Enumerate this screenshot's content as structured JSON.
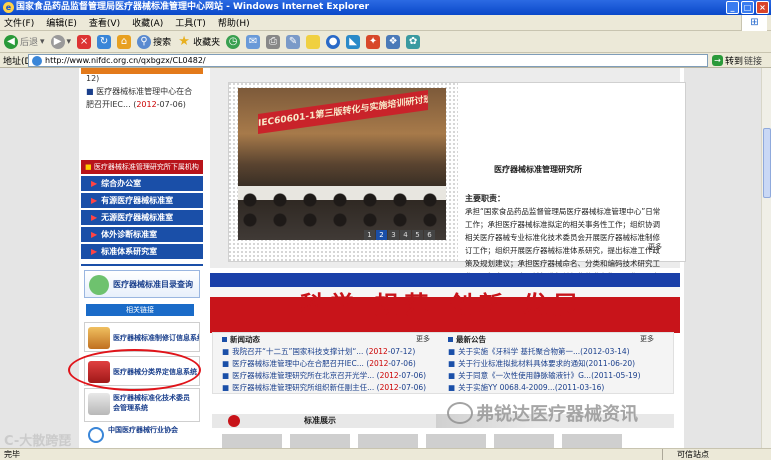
{
  "window": {
    "title": "国家食品药品监督管理局医疗器械标准管理中心网站 - Windows Internet Explorer",
    "title_bar_color": "#0a48c9"
  },
  "menu": [
    "文件(F)",
    "编辑(E)",
    "查看(V)",
    "收藏(A)",
    "工具(T)",
    "帮助(H)"
  ],
  "toolbar": {
    "back": "后退",
    "search": "搜索",
    "favorites": "收藏夹"
  },
  "address": {
    "label": "地址(D)",
    "url": "http://www.nifdc.org.cn/qxbgzx/CL0482/",
    "go": "转到",
    "links": "链接"
  },
  "left": {
    "news": [
      {
        "text": "12)",
        "date": ""
      },
      {
        "text": "医疗器械标准管理中心在合肥召开IEC...",
        "date_prefix": "(",
        "year": "2012",
        "date": "-07-06)"
      }
    ],
    "agency_header": "医疗器械标准管理研究所下属机构",
    "agency_items": [
      "综合办公室",
      "有源医疗器械标准室",
      "无源医疗器械标准室",
      "体外诊断标准室",
      "标准体系研究室"
    ],
    "query_button": "医疗器械标准目录查询",
    "related_links": "相关链接",
    "systems": [
      "医疗器械标准制修订信息系统",
      "医疗器械分类界定信息系统",
      "医疗器械标准化技术委员会管理系统"
    ],
    "assoc": "中国医疗器械行业协会"
  },
  "feature": {
    "banner": "IEC60601-1第三版转化与实施培训研讨班第二次工作会议",
    "pager": [
      "1",
      "2",
      "3",
      "4",
      "5",
      "6"
    ],
    "active_page": "2",
    "title": "医疗器械标准管理研究所",
    "duty_label": "主要职责：",
    "duty_text": "承担“国家食品药品监督管理局医疗器械标准管理中心”日常工作；承担医疗器械标准拟定的相关事务性工作；组织协调相关医疗器械专业标准化技术委员会开展医疗器械标准制修订工作；组织开展医疗器械标准体系研究，提出标准工作政策及规划建议；承担医疗器械命名、分类和编码技术研究工作；承担全国医疗器械标准相关机构的业务指导工作；承办院交办的其他事项。",
    "more": "更多"
  },
  "slogan": "科学 规范 创新 发展",
  "news": {
    "header": "新闻动态",
    "more": "更多",
    "items": [
      {
        "text": "我院召开“十二五”国家科技支撑计划“...",
        "year": "2012",
        "date": "-07-12"
      },
      {
        "text": "医疗器械标准管理中心在合肥召开IEC...",
        "year": "2012",
        "date": "-07-06"
      },
      {
        "text": "医疗器械标准管理研究所在北京召开光学...",
        "year": "2012",
        "date": "-07-06"
      },
      {
        "text": "医疗器械标准管理研究所组织新任副主任...",
        "year": "2012",
        "date": "-07-06"
      }
    ]
  },
  "notices": {
    "header": "最新公告",
    "more": "更多",
    "items": [
      {
        "text": "关于实施《牙科学 基托聚合物第一...",
        "date": "(2012-03-14)"
      },
      {
        "text": "关于行业标准拟批材料具体要求的通知",
        "date": "(2011-06-20)"
      },
      {
        "text": "关于同意《一次性使用静脉输液针》G...",
        "date": "(2011-05-19)"
      },
      {
        "text": "关于实施YY 0068.4-2009...",
        "date": "(2011-03-16)"
      }
    ]
  },
  "standards": {
    "label": "标准展示"
  },
  "watermark": "弗锐达医疗器械资讯",
  "watermark2": "C-大散跨琵",
  "status": {
    "left": "完毕",
    "right": "可信站点"
  }
}
